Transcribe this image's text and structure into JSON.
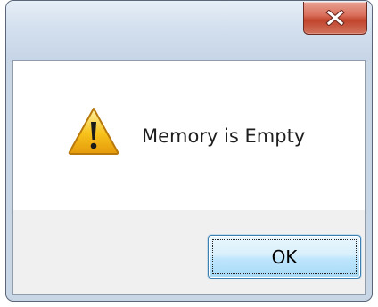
{
  "dialog": {
    "close_button": {
      "icon": "close-icon",
      "label": ""
    },
    "icon": "warning-icon",
    "message": "Memory is Empty",
    "ok_label": "OK"
  },
  "colors": {
    "close_red": "#c1442c",
    "frame_blue": "#c9d6e6",
    "button_blue": "#bee6fd",
    "button_border": "#3c7fb1",
    "warning_yellow": "#f7c21a"
  }
}
